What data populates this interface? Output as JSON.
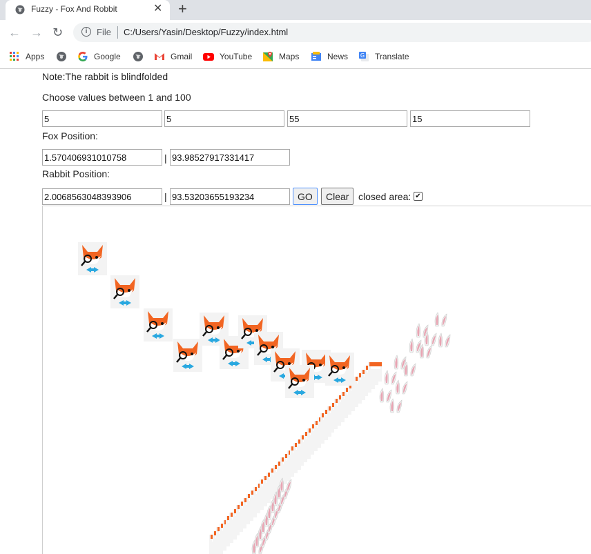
{
  "browser": {
    "tab_title": "Fuzzy - Fox And Robbit",
    "close_glyph": "✕",
    "new_tab_glyph": "+",
    "scheme_label": "File",
    "url": "C:/Users/Yasin/Desktop/Fuzzy/index.html",
    "bookmarks": [
      {
        "label": "Apps",
        "icon": "apps-grid-icon"
      },
      {
        "label": "",
        "icon": "globe-icon"
      },
      {
        "label": "Google",
        "icon": "google-icon"
      },
      {
        "label": "",
        "icon": "globe-icon"
      },
      {
        "label": "Gmail",
        "icon": "gmail-icon"
      },
      {
        "label": "YouTube",
        "icon": "youtube-icon"
      },
      {
        "label": "Maps",
        "icon": "maps-icon"
      },
      {
        "label": "News",
        "icon": "news-icon"
      },
      {
        "label": "Translate",
        "icon": "translate-icon"
      }
    ]
  },
  "page": {
    "note": "Note:The rabbit is blindfolded",
    "instruction": "Choose values between 1 and 100",
    "values": [
      "5",
      "5",
      "55",
      "15"
    ],
    "fox_label": "Fox Position:",
    "fox_x": "1.570406931010758",
    "fox_y": "93.98527917331417",
    "separator": "|",
    "rabbit_label": "Rabbit Position:",
    "rabbit_x": "2.0068563048393906",
    "rabbit_y": "93.53203655193234",
    "go_label": "GO",
    "clear_label": "Clear",
    "closed_area_label": "closed area:",
    "closed_area_checked": true
  },
  "colors": {
    "fox_orange": "#f26522",
    "fox_white": "#ffffff",
    "bowtie_blue": "#29a8e0",
    "rabbit_pink": "#e8a5b3",
    "rabbit_grey": "#f0f0f0"
  }
}
